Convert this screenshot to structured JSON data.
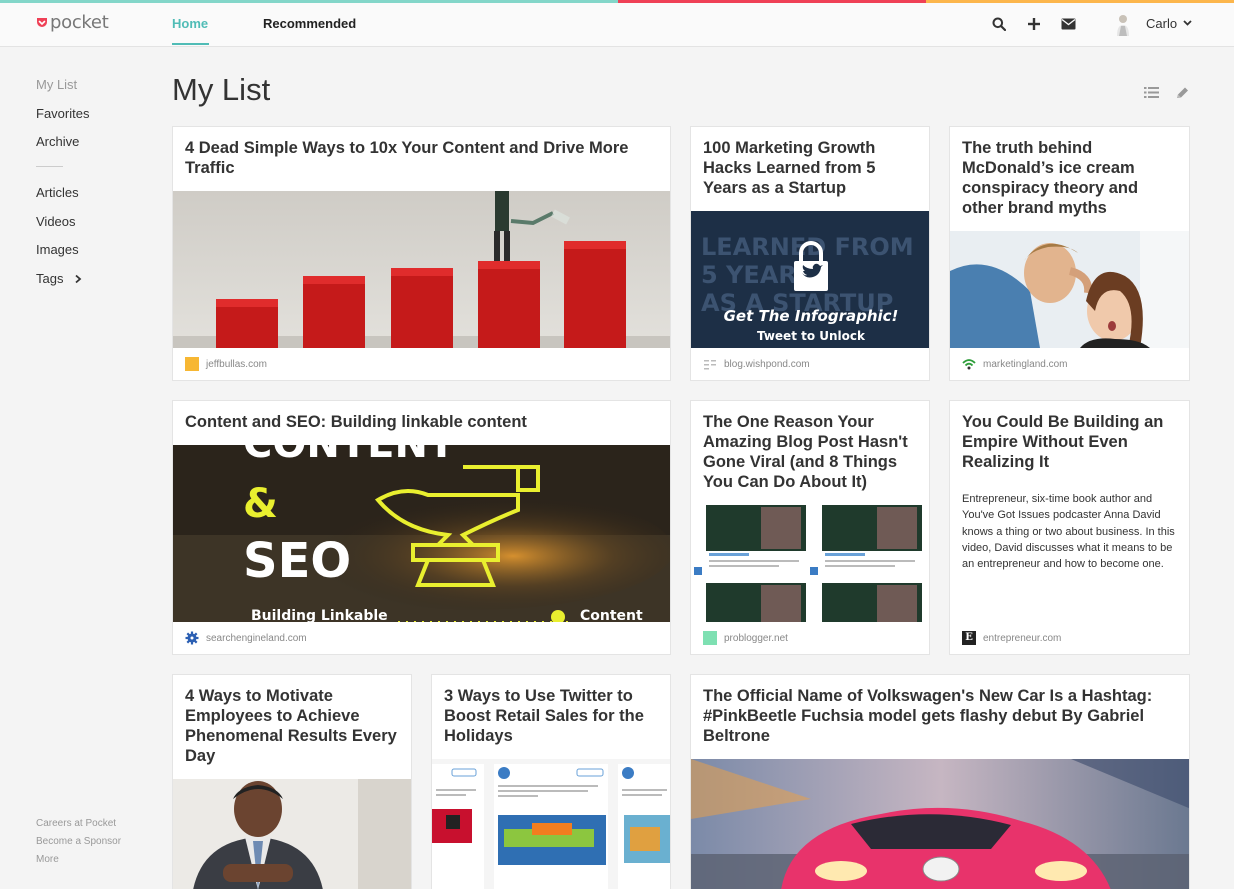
{
  "app": {
    "name": "pocket"
  },
  "colors": {
    "accent": "#50bcb6",
    "brand": "#ef4056",
    "stripe": [
      "#83d6c9",
      "#ef4056",
      "#fcb64c"
    ]
  },
  "header": {
    "tabs": [
      {
        "label": "Home",
        "active": true
      },
      {
        "label": "Recommended",
        "active": false
      }
    ],
    "icons": [
      "search-icon",
      "add-icon",
      "mail-icon"
    ],
    "user": {
      "name": "Carlo"
    }
  },
  "sidebar": {
    "primary": [
      {
        "label": "My List",
        "active": true
      },
      {
        "label": "Favorites"
      },
      {
        "label": "Archive"
      }
    ],
    "filters": [
      {
        "label": "Articles"
      },
      {
        "label": "Videos"
      },
      {
        "label": "Images"
      },
      {
        "label": "Tags",
        "has_chevron": true
      }
    ],
    "footer": [
      "Careers at Pocket",
      "Become a Sponsor",
      "More"
    ]
  },
  "main": {
    "title": "My List",
    "view_icons": [
      "list-view-icon",
      "edit-icon"
    ],
    "cards": [
      {
        "title": "4 Dead Simple Ways to 10x Your Content and Drive More Traffic",
        "source": "jeffbullas.com"
      },
      {
        "title": "100 Marketing Growth Hacks Learned from 5 Years as a Startup",
        "source": "blog.wishpond.com",
        "image_text": {
          "line1": "LEARNED FROM",
          "line2": "5 YEARS",
          "line3": "AS A STARTUP",
          "cta": "Get The Infographic!",
          "cta2": "Tweet to Unlock"
        }
      },
      {
        "title": "The truth behind McDonald’s ice cream conspiracy theory and other brand myths",
        "source": "marketingland.com"
      },
      {
        "title": "Content and SEO: Building linkable content",
        "source": "searchengineland.com",
        "image_text": {
          "top": "CONTENT",
          "amp": "&",
          "seo": "SEO",
          "bottom": "Building Linkable",
          "bottom_right": "Content"
        }
      },
      {
        "title": "The One Reason Your Amazing Blog Post Hasn't Gone Viral (and 8 Things You Can Do About It)",
        "source": "problogger.net"
      },
      {
        "title": "You Could Be Building an Empire Without Even Realizing It",
        "source": "entrepreneur.com",
        "excerpt": "Entrepreneur, six-time book author and You've Got Issues podcaster Anna David knows a thing or two about business. In this video, David discusses what it means to be an entrepreneur and how to become one."
      },
      {
        "title": "4 Ways to Motivate Employees to Achieve Phenomenal Results Every Day"
      },
      {
        "title": "3 Ways to Use Twitter to Boost Retail Sales for the Holidays"
      },
      {
        "title": "The Official Name of Volkswagen's New Car Is a Hashtag: #PinkBeetle Fuchsia model gets flashy debut By Gabriel Beltrone"
      }
    ]
  }
}
